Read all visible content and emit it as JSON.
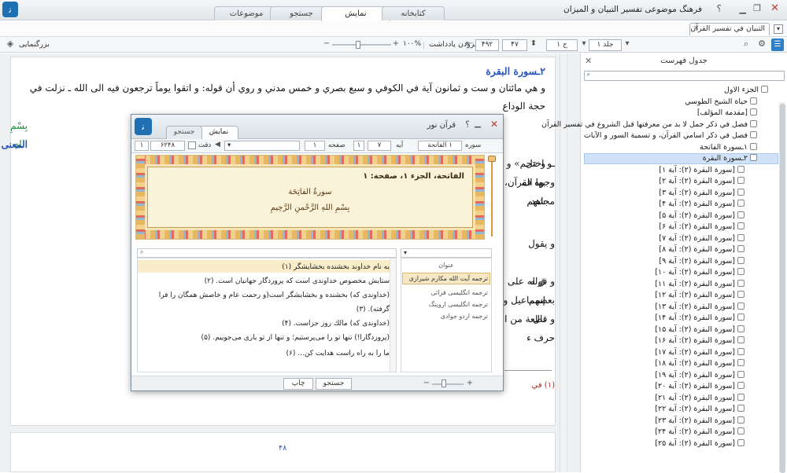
{
  "window": {
    "title": "فرهنگ موضوعی تفسير التبيان و الميزان",
    "help": "؟",
    "tabs": [
      "کتابخانه",
      "نمایش",
      "جستجو",
      "موضوعات"
    ]
  },
  "doc_tab": {
    "title": "التبيان في تفسير القرآن",
    "close": "×"
  },
  "toolbar": {
    "enlarge_label": "بزرگنمایی",
    "volume_label": "جلد ۱",
    "juz_value": "ج ۱",
    "page_value": "۴۷",
    "page_total": "۴۹۲",
    "add_note_label": "افزودن یادداشت",
    "zoom_value": "۱۰۰%"
  },
  "content": {
    "heading": "٢ـسورة البقرة",
    "paragraph1": "و هي مائتان و ست و ثمانون آية في الكوفي و سبع بصري و خمس مدني و روي أن قوله: و اتقوا يوماً ترجعون فيه الى الله ـ نزلت في حجة الوداع",
    "basmala": "بِسْمِ اللهِ",
    "section": "المعنى",
    "line_a": "ـو اختل",
    "line_a_end": "و «حم» و غير ذلك على",
    "line_b_start": "وجوه ف",
    "line_b_end": "بها القرآن، روي ذلك عن",
    "line_c_start": "مجاهد",
    "line_c_end": "شهم",
    "line_d": "و يقول",
    "line_e_start": "و قوله",
    "line_e_end": "ق له على ما قبله و قال",
    "line_f_start": "بعضهم",
    "line_f_end": "إسماعيل و عن الشعبي",
    "line_g_start": "و قال",
    "line_g_end": "نطعة من اسماء واقعاً كل",
    "line_h_start": "حرف ء",
    "footnote_start": "(١) في",
    "page_number": "۴۸"
  },
  "toc": {
    "title": "جدول فهرست",
    "items": [
      "الجزء الاول",
      "حياة الشيخ الطوسي",
      "[مقدمة المؤلف]",
      "فصل في ذكر جمل لا بد من معرفتها قبل الشروع في تفسير القرآن",
      "فصل في ذكر اسامي القرآن، و تسمية السور و الآيات",
      "١ـسورة الفاتحة",
      "٢ـسورة البقرة",
      "[سورة البقرة (٢): آية ١]",
      "[سورة البقرة (٢): آية ٢]",
      "[سورة البقرة (٢): آية ٣]",
      "[سورة البقرة (٢): آية ۴]",
      "[سورة البقرة (٢): آية ۵]",
      "[سورة البقرة (٢): آية ۶]",
      "[سورة البقرة (٢): آية ٧]",
      "[سورة البقرة (٢): آية ٨]",
      "[سورة البقرة (٢): آية ٩]",
      "[سورة البقرة (٢): آية ١٠]",
      "[سورة البقرة (٢): آية ١١]",
      "[سورة البقرة (٢): آية ١٢]",
      "[سورة البقرة (٢): آية ١٣]",
      "[سورة البقرة (٢): آية ١۴]",
      "[سورة البقرة (٢): آية ١۵]",
      "[سورة البقرة (٢): آية ١۶]",
      "[سورة البقرة (٢): آية ١٧]",
      "[سورة البقرة (٢): آية ١٨]",
      "[سورة البقرة (٢): آية ١٩]",
      "[سورة البقرة (٢): آية ٢٠]",
      "[سورة البقرة (٢): آية ٢١]",
      "[سورة البقرة (٢): آية ٢٢]",
      "[سورة البقرة (٢): آية ٢٣]",
      "[سورة البقرة (٢): آية ٢۴]",
      "[سورة البقرة (٢): آية ٢۵]"
    ]
  },
  "dialog": {
    "title": "قرآن نور",
    "help": "؟",
    "tabs": [
      "نمایش",
      "جستجو"
    ],
    "nav": {
      "sura_label": "سوره",
      "sura_value": "١ الفاتحة",
      "aya_label": "آیه",
      "aya_value": "٧",
      "aya_from": "١",
      "page_label": "صفحه",
      "page_value": "١",
      "exact_label": "دقت",
      "count_value": "۶۲۴۸",
      "count_from": "١"
    },
    "frame_title": "الفاتحة، الجزء ١، صفحة: ١",
    "sura_name": "سورةُ الفاتِحَة",
    "basmala": "بِسْمِ اللهِ الرَّحْمنِ الرَّحِيمِ",
    "verses": [
      "به نام خداوند بخشنده بخشايشگر (١)",
      "ستايش مخصوص خداوندى است كه پروردگار جهانيان است. (٢)",
      "(خداوندى كه) بخشنده و بخشايشگر است(و رحمت عام و خاصش همگان را فرا",
      "گرفته). (٣)",
      "(خداوندى كه) مالك روز جزاست. (۴)",
      "(پروردگارا!) تنها تو را مى‌پرستيم؛ و تنها از تو يارى مى‌جوييم. (۵)",
      "ما را به راه راست هدايت كن... (۶)"
    ],
    "translations_header": "عنوان",
    "translations": [
      "ترجمه آیت الله مکارم شیرازی",
      "ترجمه انگلیسی قرائی",
      "ترجمه انگلیسی اروینگ",
      "ترجمه اردو جوادی"
    ],
    "print_label": "چاپ",
    "search_label": "جستجو"
  }
}
